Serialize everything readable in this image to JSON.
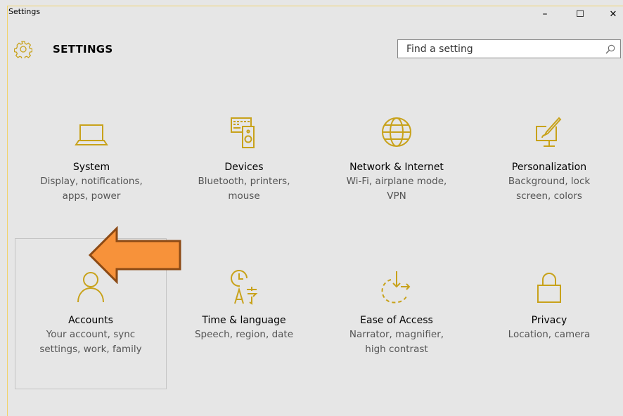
{
  "window": {
    "title": "Settings",
    "minimize_glyph": "–",
    "maximize_glyph": "☐",
    "close_glyph": "✕"
  },
  "header": {
    "title": "SETTINGS",
    "icon": "gear-icon"
  },
  "search": {
    "placeholder": "Find a setting",
    "icon": "search-icon"
  },
  "accent_color": "#c8a21b",
  "arrow_color": "#f7923a",
  "tiles": [
    {
      "label": "System",
      "desc1": "Display, notifications,",
      "desc2": "apps, power",
      "icon": "laptop-icon"
    },
    {
      "label": "Devices",
      "desc1": "Bluetooth, printers,",
      "desc2": "mouse",
      "icon": "keyboard-speaker-icon"
    },
    {
      "label": "Network & Internet",
      "desc1": "Wi-Fi, airplane mode,",
      "desc2": "VPN",
      "icon": "globe-icon"
    },
    {
      "label": "Personalization",
      "desc1": "Background, lock",
      "desc2": "screen, colors",
      "icon": "paintbrush-monitor-icon"
    },
    {
      "label": "Accounts",
      "desc1": "Your account, sync",
      "desc2": "settings, work, family",
      "icon": "person-icon"
    },
    {
      "label": "Time & language",
      "desc1": "Speech, region, date",
      "desc2": "",
      "icon": "clock-language-icon"
    },
    {
      "label": "Ease of Access",
      "desc1": "Narrator, magnifier,",
      "desc2": "high contrast",
      "icon": "ease-of-access-icon"
    },
    {
      "label": "Privacy",
      "desc1": "Location, camera",
      "desc2": "",
      "icon": "lock-icon"
    }
  ]
}
